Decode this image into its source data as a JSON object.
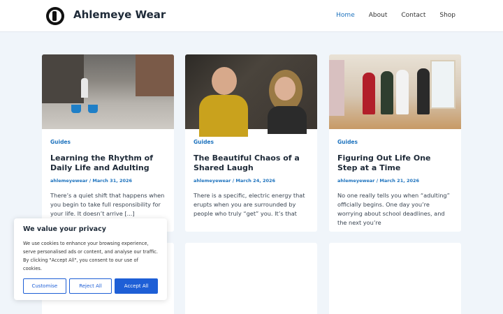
{
  "site": {
    "title": "Ahlemeye Wear"
  },
  "nav": [
    {
      "label": "Home",
      "active": true
    },
    {
      "label": "About"
    },
    {
      "label": "Contact"
    },
    {
      "label": "Shop"
    }
  ],
  "posts": [
    {
      "category": "Guides",
      "title": "Learning the Rhythm of Daily Life and Adulting",
      "meta": "ahlemeyewear / March 31, 2026",
      "excerpt": "There’s a quiet shift that happens when you begin to take full responsibility for your life. It doesn’t arrive [...]"
    },
    {
      "category": "Guides",
      "title": "The Beautiful Chaos of a Shared Laugh",
      "meta": "ahlemeyewear / March 24, 2026",
      "excerpt": "There is a specific, electric energy that erupts when you are surrounded by people who truly “get” you. It’s that"
    },
    {
      "category": "Guides",
      "title": "Figuring Out Life One Step at a Time",
      "meta": "ahlemeyewear / March 21, 2026",
      "excerpt": "No one really tells you when “adulting” officially begins. One day you’re worrying about school deadlines, and the next you’re"
    }
  ],
  "cookie": {
    "title": "We value your privacy",
    "text": "We use cookies to enhance your browsing experience, serve personalised ads or content, and analyse our traffic. By clicking \"Accept All\", you consent to our use of cookies.",
    "customise": "Customise",
    "reject": "Reject All",
    "accept": "Accept All"
  }
}
